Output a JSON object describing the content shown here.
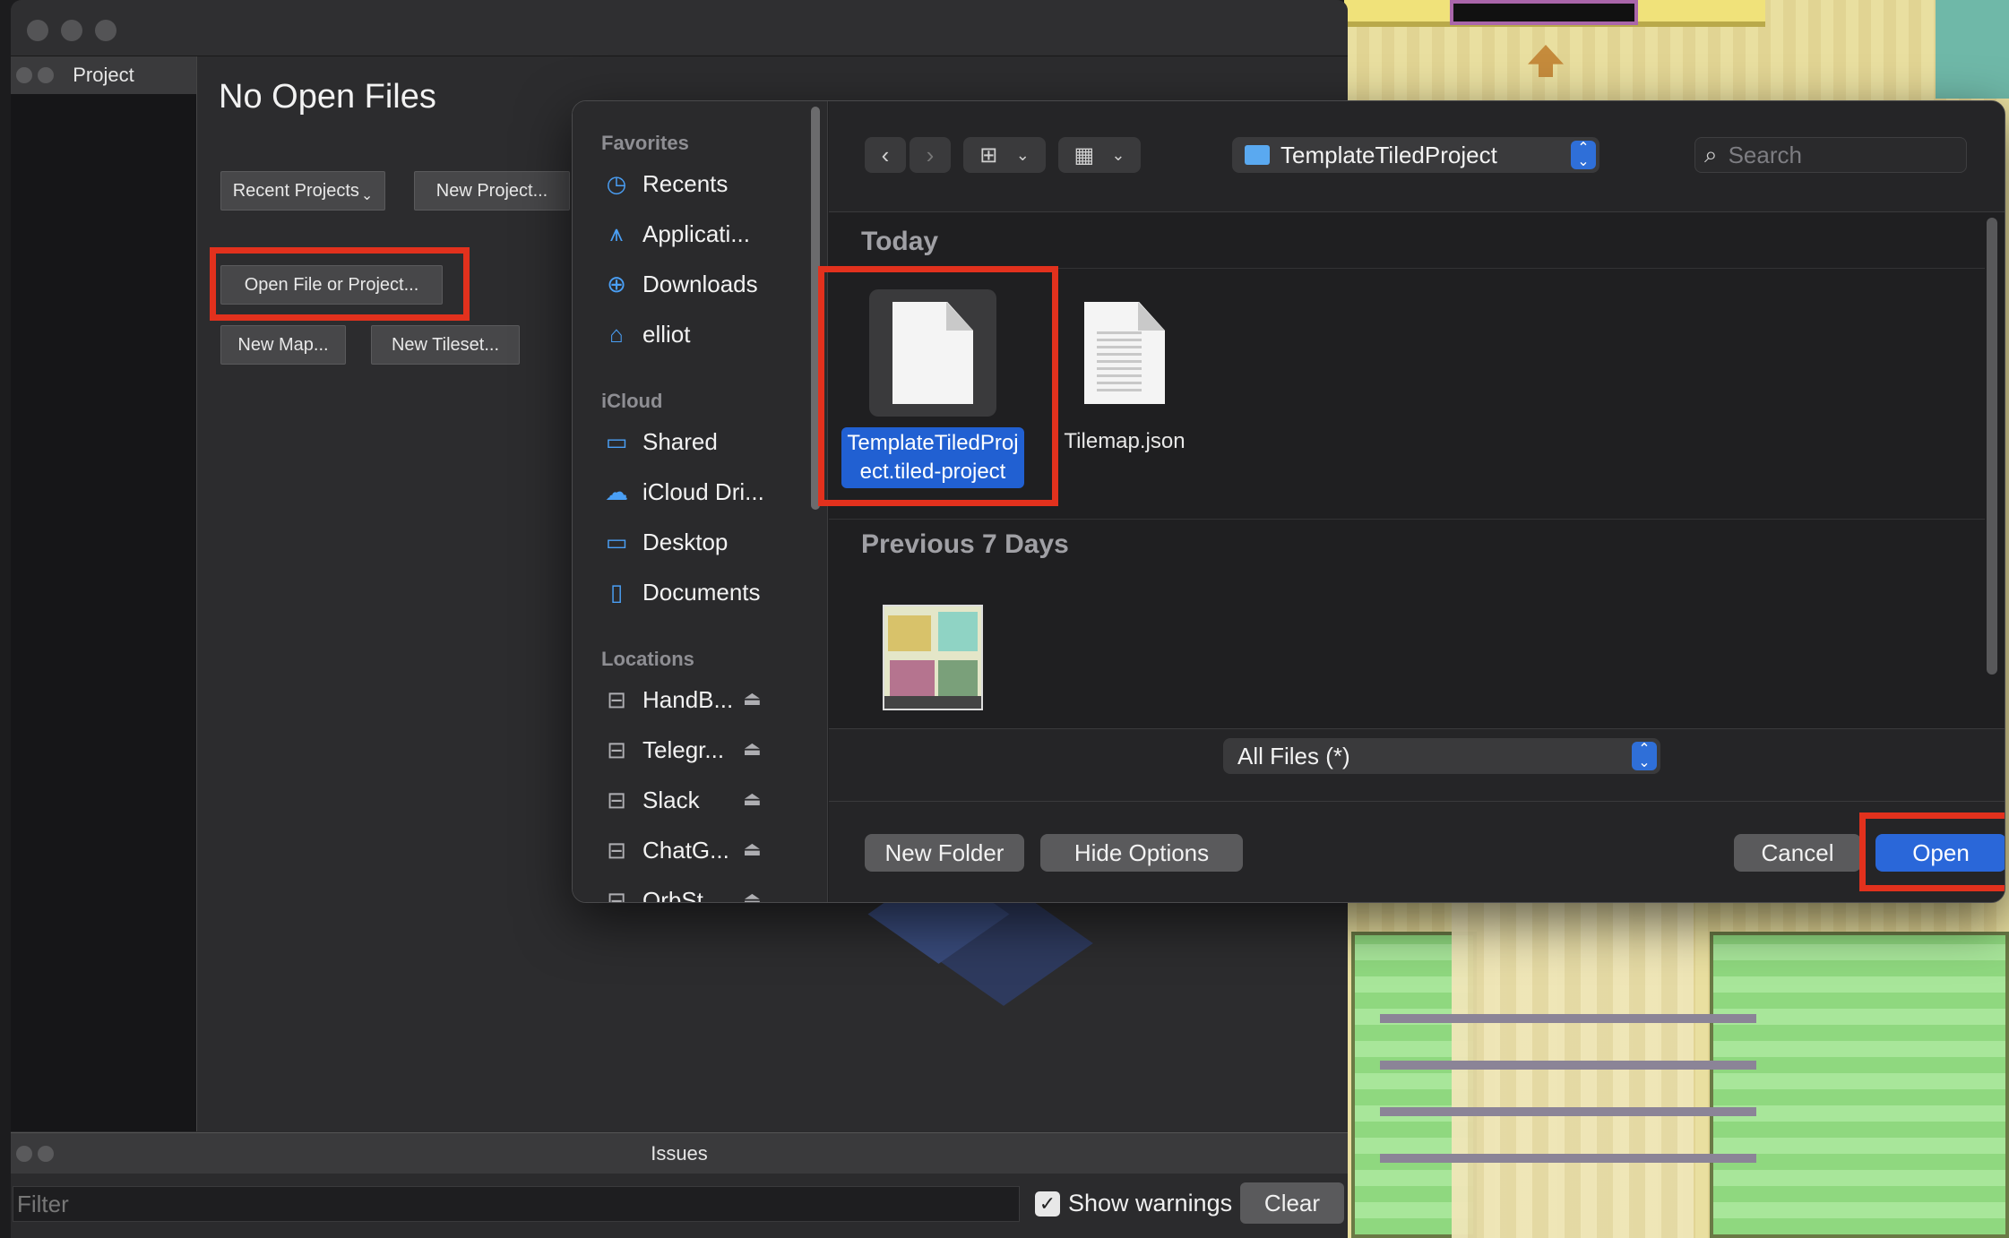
{
  "tiled": {
    "project_tab": "Project",
    "no_open_title": "No Open Files",
    "buttons": {
      "recent_projects": "Recent Projects",
      "new_project": "New Project...",
      "open_file_or_project": "Open File or Project...",
      "new_map": "New Map...",
      "new_tileset": "New Tileset..."
    },
    "issues_title": "Issues",
    "filter_placeholder": "Filter",
    "show_warnings_label": "Show warnings",
    "show_warnings_checked": true,
    "clear_label": "Clear"
  },
  "dialog": {
    "sidebar": {
      "favorites_header": "Favorites",
      "favorites": [
        {
          "label": "Recents",
          "icon": "clock-icon"
        },
        {
          "label": "Applicati...",
          "icon": "applications-icon"
        },
        {
          "label": "Downloads",
          "icon": "download-icon"
        },
        {
          "label": "elliot",
          "icon": "home-icon"
        }
      ],
      "icloud_header": "iCloud",
      "icloud": [
        {
          "label": "Shared",
          "icon": "shared-folder-icon"
        },
        {
          "label": "iCloud Dri...",
          "icon": "cloud-icon"
        },
        {
          "label": "Desktop",
          "icon": "desktop-icon"
        },
        {
          "label": "Documents",
          "icon": "document-icon"
        }
      ],
      "locations_header": "Locations",
      "locations": [
        {
          "label": "HandB...",
          "icon": "drive-icon"
        },
        {
          "label": "Telegr...",
          "icon": "drive-icon"
        },
        {
          "label": "Slack",
          "icon": "drive-icon"
        },
        {
          "label": "ChatG...",
          "icon": "drive-icon"
        },
        {
          "label": "OrbSt...",
          "icon": "drive-icon"
        }
      ]
    },
    "toolbar": {
      "back_icon": "chevron-left-icon",
      "forward_icon": "chevron-right-icon",
      "current_folder": "TemplateTiledProject",
      "search_placeholder": "Search"
    },
    "sections": {
      "today": "Today",
      "previous_7_days": "Previous 7 Days"
    },
    "files_today": [
      {
        "line1": "TemplateTiledProj",
        "line2": "ect.tiled-project",
        "selected": true
      },
      {
        "line1": "Tilemap.json",
        "line2": "",
        "selected": false
      }
    ],
    "file_type": "All Files (*)",
    "buttons": {
      "new_folder": "New Folder",
      "hide_options": "Hide Options",
      "cancel": "Cancel",
      "open": "Open"
    }
  },
  "colors": {
    "highlight_red": "#e2311d",
    "accent_blue": "#2a67d9",
    "selection_blue": "#2160d2"
  }
}
